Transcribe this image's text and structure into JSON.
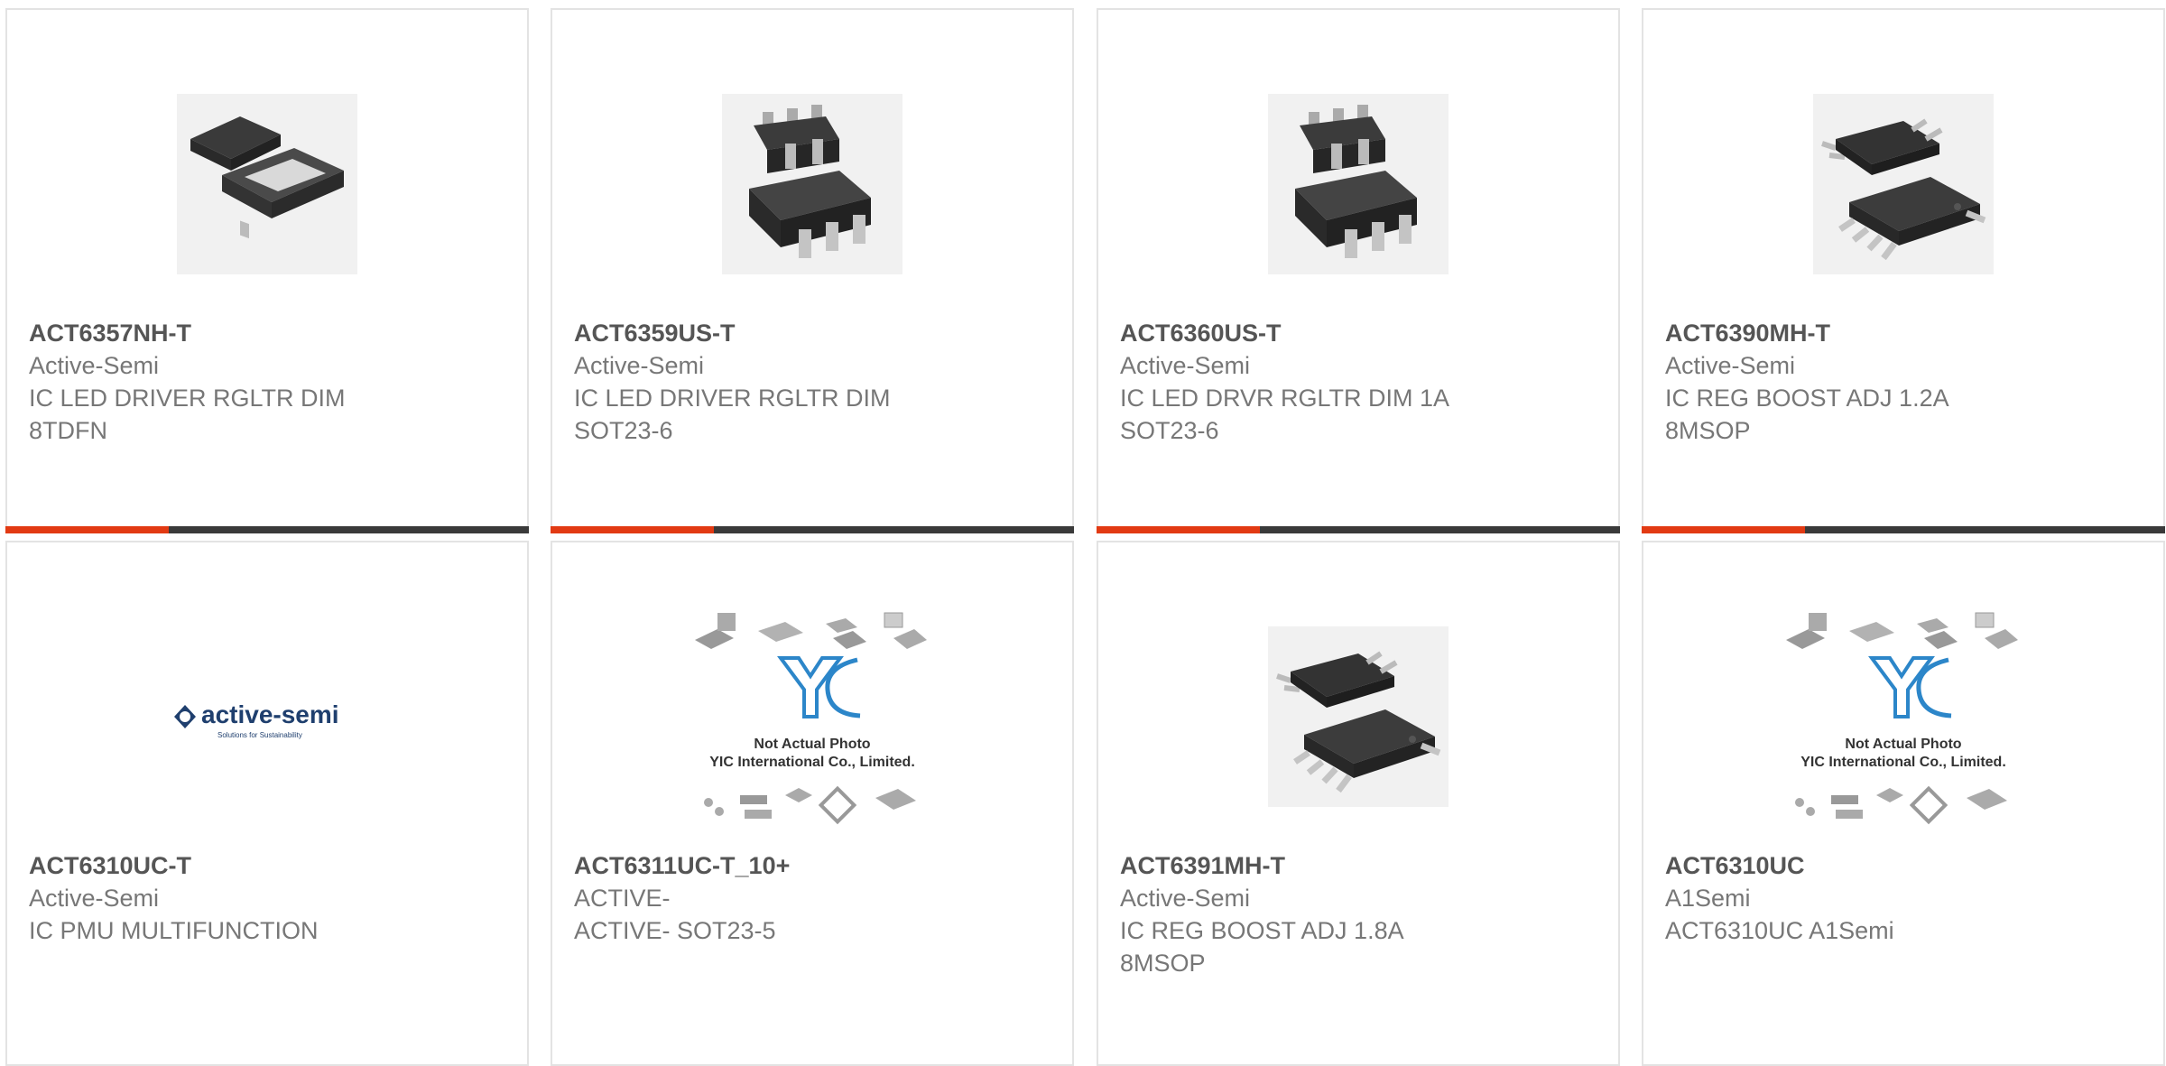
{
  "colors": {
    "accent": "#e23a13",
    "bar": "#3a3a3a",
    "border": "#e3e3e3"
  },
  "products": [
    {
      "part": "ACT6357NH-T",
      "manufacturer": "Active-Semi",
      "description": "IC LED DRIVER RGLTR DIM\n8TDFN",
      "image": "dfn-package",
      "accent_fraction": 0.31
    },
    {
      "part": "ACT6359US-T",
      "manufacturer": "Active-Semi",
      "description": "IC LED DRIVER RGLTR DIM\nSOT23-6",
      "image": "sot23-package",
      "accent_fraction": 0.31
    },
    {
      "part": "ACT6360US-T",
      "manufacturer": "Active-Semi",
      "description": "IC LED DRVR RGLTR DIM 1A\nSOT23-6",
      "image": "sot23-package",
      "accent_fraction": 0.31
    },
    {
      "part": "ACT6390MH-T",
      "manufacturer": "Active-Semi",
      "description": "IC REG BOOST ADJ 1.2A\n8MSOP",
      "image": "msop-package",
      "accent_fraction": 0.31
    },
    {
      "part": "ACT6310UC-T",
      "manufacturer": "Active-Semi",
      "description": "IC PMU MULTIFUNCTION",
      "image": "active-semi-logo",
      "logo_text": "active-semi",
      "logo_tagline": "Solutions for Sustainability"
    },
    {
      "part": "ACT6311UC-T_10+",
      "manufacturer": "ACTIVE-",
      "description": "ACTIVE- SOT23-5",
      "image": "yic-placeholder",
      "placeholder_lines": [
        "Not Actual Photo",
        "YIC International Co., Limited."
      ]
    },
    {
      "part": "ACT6391MH-T",
      "manufacturer": "Active-Semi",
      "description": "IC REG BOOST ADJ 1.8A\n8MSOP",
      "image": "msop-package"
    },
    {
      "part": "ACT6310UC",
      "manufacturer": "A1Semi",
      "description": "ACT6310UC A1Semi",
      "image": "yic-placeholder",
      "placeholder_lines": [
        "Not Actual Photo",
        "YIC International Co., Limited."
      ]
    }
  ]
}
